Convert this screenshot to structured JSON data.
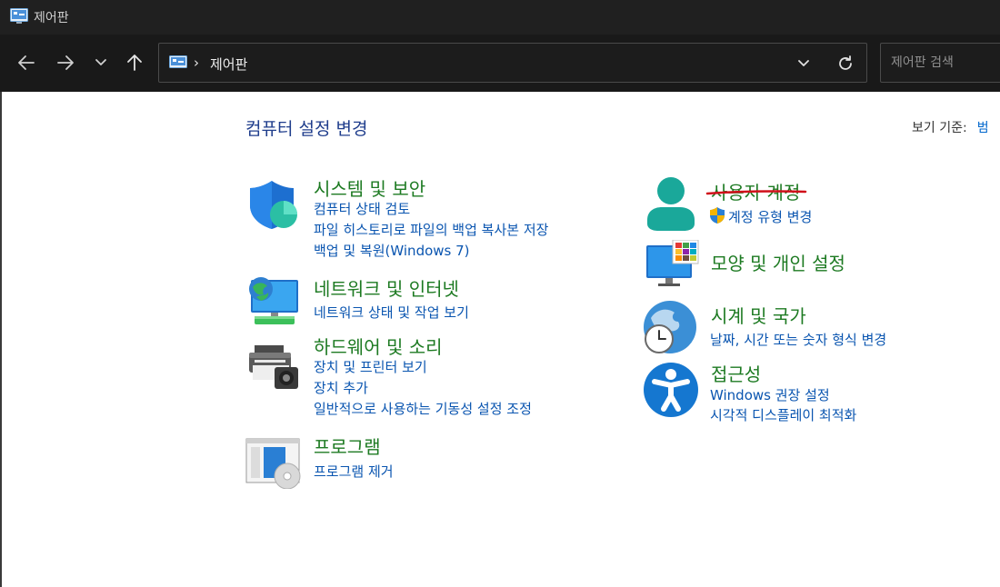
{
  "window": {
    "title": "제어판"
  },
  "nav": {
    "back_icon": "back-arrow-icon",
    "forward_icon": "forward-arrow-icon",
    "recent_icon": "chevron-down-icon",
    "up_icon": "up-arrow-icon"
  },
  "address": {
    "separator": "›",
    "location": "제어판"
  },
  "search": {
    "placeholder": "제어판 검색"
  },
  "page": {
    "title": "컴퓨터 설정 변경",
    "viewby_label": "보기 기준:",
    "viewby_value": "범"
  },
  "categories_left": [
    {
      "heading": "시스템 및 보안",
      "links": [
        "컴퓨터 상태 검토",
        "파일 히스토리로 파일의 백업 복사본 저장",
        "백업 및 복원(Windows 7)"
      ]
    },
    {
      "heading": "네트워크 및 인터넷",
      "links": [
        "네트워크 상태 및 작업 보기"
      ]
    },
    {
      "heading": "하드웨어 및 소리",
      "links": [
        "장치 및 프린터 보기",
        "장치 추가",
        "일반적으로 사용하는 기동성 설정 조정"
      ]
    },
    {
      "heading": "프로그램",
      "links": [
        "프로그램 제거"
      ]
    }
  ],
  "categories_right": [
    {
      "heading": "사용자 계정",
      "links": [
        "계정 유형 변경"
      ]
    },
    {
      "heading": "모양 및 개인 설정",
      "links": []
    },
    {
      "heading": "시계 및 국가",
      "links": [
        "날짜, 시간 또는 숫자 형식 변경"
      ]
    },
    {
      "heading": "접근성",
      "links": [
        "Windows 권장 설정",
        "시각적 디스플레이 최적화"
      ]
    }
  ],
  "colors": {
    "heading": "#1d7a22",
    "link": "#0a55b0",
    "underline": "#d0101a"
  }
}
